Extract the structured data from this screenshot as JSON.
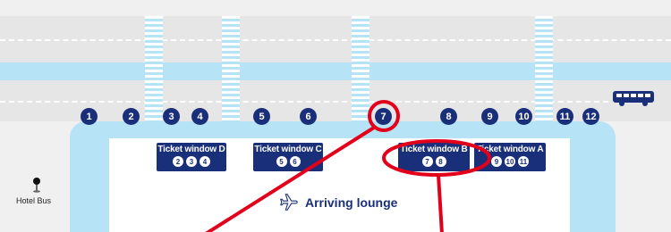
{
  "stops": [
    "1",
    "2",
    "3",
    "4",
    "5",
    "6",
    "7",
    "8",
    "9",
    "10",
    "11",
    "12"
  ],
  "ticket_windows": [
    {
      "label": "Ticket window D",
      "numbers": [
        "2",
        "3",
        "4"
      ]
    },
    {
      "label": "Ticket window C",
      "numbers": [
        "5",
        "6"
      ]
    },
    {
      "label": "Ticket window B",
      "numbers": [
        "7",
        "8"
      ]
    },
    {
      "label": "Ticket window A",
      "numbers": [
        "9",
        "10",
        "11"
      ]
    }
  ],
  "lounge_label": "Arriving lounge",
  "hotel_bus_label": "Hotel Bus",
  "highlight_color": "#e3001b",
  "brand_color": "#1a2f7a",
  "icons": {
    "plane": "plane-icon",
    "bus": "bus-icon",
    "pin": "map-pin-icon"
  }
}
